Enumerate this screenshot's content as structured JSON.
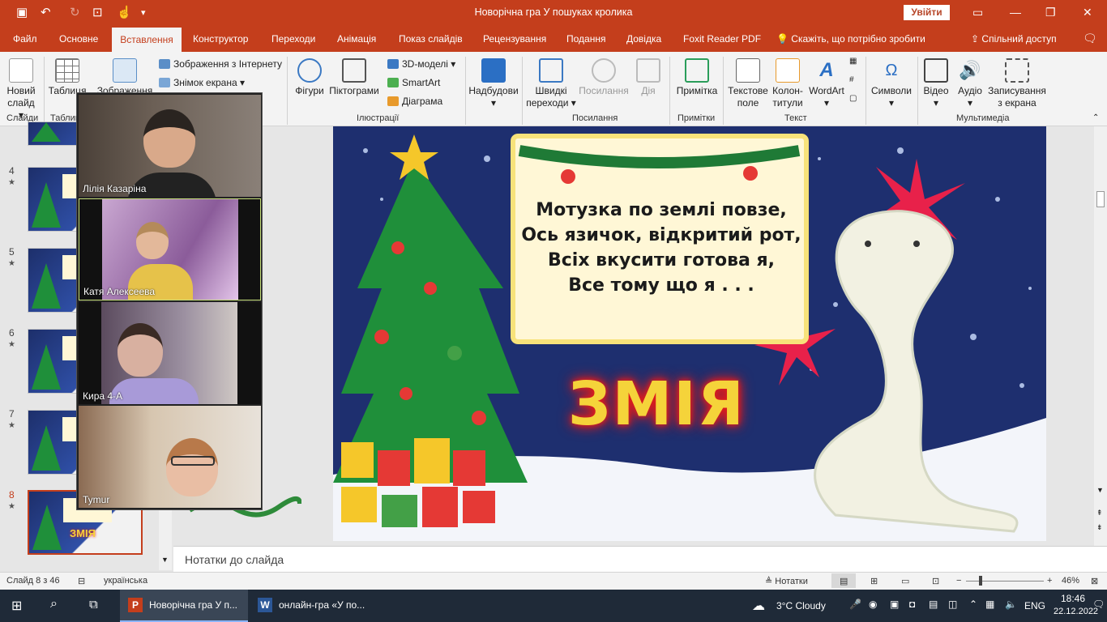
{
  "window": {
    "title": "Новорічна гра У пошуках кролика",
    "signin": "Увійти",
    "controls": [
      "—",
      "❐",
      "✕"
    ]
  },
  "tabs": [
    "Файл",
    "Основне",
    "Вставлення",
    "Конструктор",
    "Переходи",
    "Анімація",
    "Показ слайдів",
    "Рецензування",
    "Подання",
    "Довідка",
    "Foxit Reader PDF"
  ],
  "tell_me": "Скажіть, що потрібно зробити",
  "share": "Спільний доступ",
  "ribbon": {
    "new_slide": [
      "Новий",
      "слайд ▾"
    ],
    "table": "Таблиця",
    "images": "Зображення",
    "online_pictures": "Зображення з Інтернету",
    "screenshot": "Знімок екрана ▾",
    "shapes": "Фігури",
    "icons": "Піктограми",
    "models3d": "3D-моделі",
    "smartart": "SmartArt",
    "chart": "Діаграма",
    "addins": "Надбудови",
    "zoom": [
      "Швидкі",
      "переходи ▾"
    ],
    "link": "Посилання",
    "action": "Дія",
    "comment": "Примітка",
    "textbox": [
      "Текстове",
      "поле"
    ],
    "header_footer": [
      "Колон-",
      "титули"
    ],
    "wordart": "WordArt",
    "symbols": "Символи",
    "video": "Відео",
    "audio": "Аудіо",
    "screen_recording": [
      "Записування",
      "з екрана"
    ],
    "groups": [
      "Слайди",
      "Таблиці",
      "Ілюстрації",
      "Посилання",
      "Примітки",
      "Текст",
      "Мультимедіа"
    ]
  },
  "thumbnails": [
    {
      "num": "4",
      "star": "★"
    },
    {
      "num": "5",
      "star": "★"
    },
    {
      "num": "6",
      "star": "★"
    },
    {
      "num": "7",
      "star": "★"
    },
    {
      "num": "8",
      "star": "★",
      "label": "ЗМІЯ"
    }
  ],
  "video_participants": [
    {
      "name": "Лілія Казаріна"
    },
    {
      "name": "Катя Алексеева"
    },
    {
      "name": "Кира 4-А"
    },
    {
      "name": "Tymur"
    }
  ],
  "slide": {
    "riddle": [
      "Мотузка по землі повзе,",
      "Ось язичок, відкритий рот,",
      "Всіх вкусити готова я,",
      "Все тому що я . . ."
    ],
    "answer": "ЗМІЯ"
  },
  "notes_placeholder": "Нотатки до слайда",
  "status": {
    "slide_counter": "Слайд 8 з 46",
    "language": "українська",
    "notes": "Нотатки",
    "zoom": "46%"
  },
  "taskbar": {
    "items": [
      {
        "label": "Новорічна гра У п..."
      },
      {
        "label": "онлайн-гра «У по..."
      }
    ],
    "weather": "3°C  Cloudy",
    "lang": "ENG",
    "time": "18:46",
    "date": "22.12.2022"
  },
  "colors": {
    "accent": "#c43e1c",
    "slide_bg": "#1e2f6f",
    "answer": "#f5d33a"
  }
}
